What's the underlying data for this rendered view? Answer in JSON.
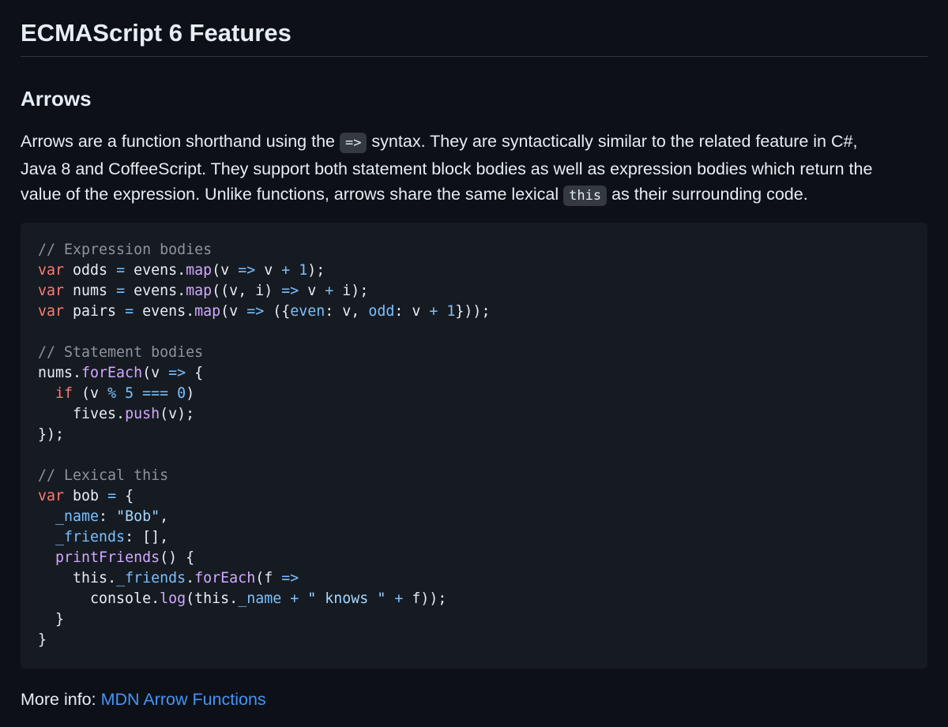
{
  "title": "ECMAScript 6 Features",
  "section_heading": "Arrows",
  "paragraph": {
    "lines": [
      [
        {
          "text": "Arrows are a function shorthand using the "
        },
        {
          "text": "=>",
          "code": true
        },
        {
          "text": " syntax. They are syntactically similar to the related feature in C#,"
        }
      ],
      [
        {
          "text": "Java 8 and CoffeeScript. They support both statement block bodies as well as expression bodies which return the"
        }
      ],
      [
        {
          "text": "value of the expression. Unlike functions, arrows share the same lexical "
        },
        {
          "text": "this",
          "code": true
        },
        {
          "text": " as their surrounding code."
        }
      ]
    ]
  },
  "code_block": {
    "language": "javascript",
    "lines": [
      [
        [
          "comment",
          "// Expression bodies"
        ]
      ],
      [
        [
          "keyword",
          "var"
        ],
        [
          "text",
          " odds "
        ],
        [
          "constant",
          "="
        ],
        [
          "text",
          " evens."
        ],
        [
          "function",
          "map"
        ],
        [
          "text",
          "(v "
        ],
        [
          "constant",
          "=>"
        ],
        [
          "text",
          " v "
        ],
        [
          "constant",
          "+"
        ],
        [
          "text",
          " "
        ],
        [
          "constant",
          "1"
        ],
        [
          "text",
          ");"
        ]
      ],
      [
        [
          "keyword",
          "var"
        ],
        [
          "text",
          " nums "
        ],
        [
          "constant",
          "="
        ],
        [
          "text",
          " evens."
        ],
        [
          "function",
          "map"
        ],
        [
          "text",
          "((v, i) "
        ],
        [
          "constant",
          "=>"
        ],
        [
          "text",
          " v "
        ],
        [
          "constant",
          "+"
        ],
        [
          "text",
          " i);"
        ]
      ],
      [
        [
          "keyword",
          "var"
        ],
        [
          "text",
          " pairs "
        ],
        [
          "constant",
          "="
        ],
        [
          "text",
          " evens."
        ],
        [
          "function",
          "map"
        ],
        [
          "text",
          "(v "
        ],
        [
          "constant",
          "=>"
        ],
        [
          "text",
          " ({"
        ],
        [
          "constant",
          "even"
        ],
        [
          "text",
          ": v, "
        ],
        [
          "constant",
          "odd"
        ],
        [
          "text",
          ": v "
        ],
        [
          "constant",
          "+"
        ],
        [
          "text",
          " "
        ],
        [
          "constant",
          "1"
        ],
        [
          "text",
          "}));"
        ]
      ],
      [],
      [
        [
          "comment",
          "// Statement bodies"
        ]
      ],
      [
        [
          "text",
          "nums."
        ],
        [
          "function",
          "forEach"
        ],
        [
          "text",
          "(v "
        ],
        [
          "constant",
          "=>"
        ],
        [
          "text",
          " {"
        ]
      ],
      [
        [
          "text",
          "  "
        ],
        [
          "keyword",
          "if"
        ],
        [
          "text",
          " (v "
        ],
        [
          "constant",
          "%"
        ],
        [
          "text",
          " "
        ],
        [
          "constant",
          "5"
        ],
        [
          "text",
          " "
        ],
        [
          "constant",
          "==="
        ],
        [
          "text",
          " "
        ],
        [
          "constant",
          "0"
        ],
        [
          "text",
          ")"
        ]
      ],
      [
        [
          "text",
          "    fives."
        ],
        [
          "function",
          "push"
        ],
        [
          "text",
          "(v);"
        ]
      ],
      [
        [
          "text",
          "});"
        ]
      ],
      [],
      [
        [
          "comment",
          "// Lexical this"
        ]
      ],
      [
        [
          "keyword",
          "var"
        ],
        [
          "text",
          " bob "
        ],
        [
          "constant",
          "="
        ],
        [
          "text",
          " {"
        ]
      ],
      [
        [
          "text",
          "  "
        ],
        [
          "constant",
          "_name"
        ],
        [
          "text",
          ": "
        ],
        [
          "string",
          "\"Bob\""
        ],
        [
          "text",
          ","
        ]
      ],
      [
        [
          "text",
          "  "
        ],
        [
          "constant",
          "_friends"
        ],
        [
          "text",
          ": [],"
        ]
      ],
      [
        [
          "text",
          "  "
        ],
        [
          "function",
          "printFriends"
        ],
        [
          "text",
          "() {"
        ]
      ],
      [
        [
          "text",
          "    "
        ],
        [
          "text",
          "this"
        ],
        [
          "text",
          "."
        ],
        [
          "constant",
          "_friends"
        ],
        [
          "text",
          "."
        ],
        [
          "function",
          "forEach"
        ],
        [
          "text",
          "(f "
        ],
        [
          "constant",
          "=>"
        ]
      ],
      [
        [
          "text",
          "      console."
        ],
        [
          "function",
          "log"
        ],
        [
          "text",
          "("
        ],
        [
          "text",
          "this"
        ],
        [
          "text",
          "."
        ],
        [
          "constant",
          "_name"
        ],
        [
          "text",
          " "
        ],
        [
          "constant",
          "+"
        ],
        [
          "text",
          " "
        ],
        [
          "string",
          "\" knows \""
        ],
        [
          "text",
          " "
        ],
        [
          "constant",
          "+"
        ],
        [
          "text",
          " f));"
        ]
      ],
      [
        [
          "text",
          "  }"
        ]
      ],
      [
        [
          "text",
          "}"
        ]
      ]
    ]
  },
  "more_info": {
    "label": "More info: ",
    "link_text": "MDN Arrow Functions"
  },
  "colors": {
    "background": "#0d1117",
    "code_background": "#161b22",
    "text": "#e6edf3",
    "comment": "#8b949e",
    "keyword": "#ff7b72",
    "function": "#d2a8ff",
    "constant": "#79c0ff",
    "string": "#a5d6ff",
    "link": "#4493f8"
  }
}
